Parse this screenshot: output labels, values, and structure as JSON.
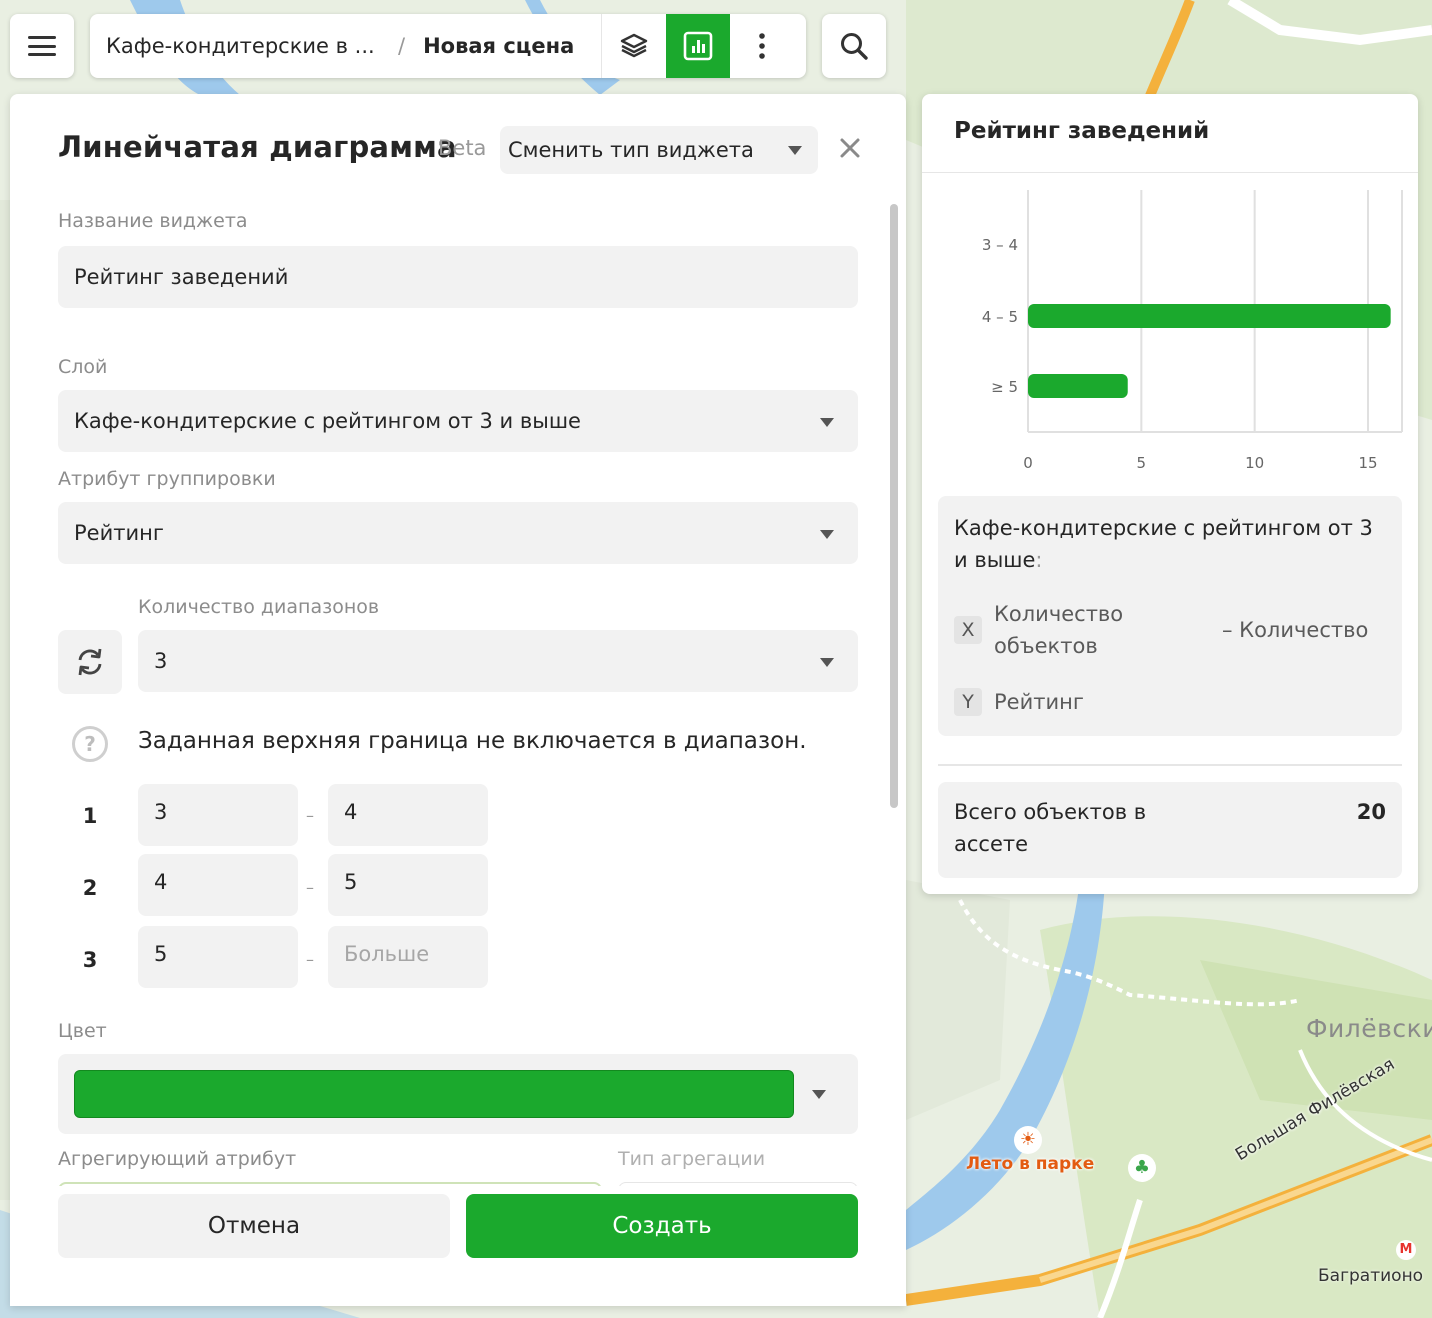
{
  "topbar": {
    "breadcrumb_asset": "Кафе-кондитерские в ...",
    "breadcrumb_separator": "/",
    "breadcrumb_scene": "Новая сцена",
    "icons": [
      "menu-icon",
      "layers-icon",
      "widgets-chart-icon",
      "more-vertical-icon",
      "search-icon"
    ]
  },
  "editor": {
    "title": "Линейчатая диаграмма",
    "beta": "Beta",
    "change_type": "Сменить тип виджета",
    "widget_name_label": "Название виджета",
    "widget_name_value": "Рейтинг заведений",
    "layer_label": "Слой",
    "layer_value": "Кафе-кондитерские с рейтингом от 3 и выше",
    "group_attr_label": "Атрибут группировки",
    "group_attr_value": "Рейтинг",
    "ranges_count_label": "Количество диапазонов",
    "ranges_count_value": "3",
    "hint_icon": "?",
    "hint": "Заданная верхняя граница не включается в диапазон.",
    "ranges": [
      {
        "num": "1",
        "from": "3",
        "to": "4"
      },
      {
        "num": "2",
        "from": "4",
        "to": "5"
      },
      {
        "num": "3",
        "from": "5",
        "to": ""
      }
    ],
    "range_dash": "–",
    "range_more_placeholder": "Больше",
    "color_label": "Цвет",
    "color_value": "#1ba92d",
    "agg_attr_label": "Агрегирующий атрибут",
    "agg_type_label": "Тип агрегации",
    "cancel": "Отмена",
    "create": "Создать"
  },
  "widget": {
    "title": "Рейтинг заведений",
    "legend_title": "Кафе-кондитерские с рейтингом от 3 и выше",
    "legend_colon": ":",
    "x_badge": "X",
    "x_label": "Количество объектов",
    "x_agg": "– Количество",
    "y_badge": "Y",
    "y_label": "Рейтинг",
    "total_label": "Всего объектов в ассете",
    "total_value": "20"
  },
  "chart_data": {
    "type": "bar",
    "orientation": "horizontal",
    "categories": [
      "3 – 4",
      "4 – 5",
      "≥ 5"
    ],
    "values": [
      0,
      16,
      4.4
    ],
    "xticks": [
      0,
      5,
      10,
      15
    ],
    "xlim": [
      0,
      16.5
    ],
    "grid": true,
    "color": "#1ba92d"
  },
  "map": {
    "park": "Лето в парке",
    "district": "Филёвски",
    "street": "Большая Филёвская",
    "metro": "Багратионо",
    "metro_icon": "М"
  }
}
